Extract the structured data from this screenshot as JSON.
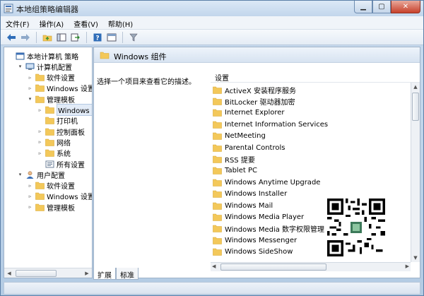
{
  "window": {
    "title": "本地组策略编辑器"
  },
  "menu": [
    "文件(F)",
    "操作(A)",
    "查看(V)",
    "帮助(H)"
  ],
  "tree": [
    {
      "label": "本地计算机 策略",
      "indent": 0,
      "icon": "computer-policy-icon",
      "expander": ""
    },
    {
      "label": "计算机配置",
      "indent": 1,
      "icon": "computer-icon",
      "expander": "▾"
    },
    {
      "label": "软件设置",
      "indent": 2,
      "icon": "folder-icon",
      "expander": "▹"
    },
    {
      "label": "Windows 设置",
      "indent": 2,
      "icon": "folder-icon",
      "expander": "▹"
    },
    {
      "label": "管理模板",
      "indent": 2,
      "icon": "folder-icon",
      "expander": "▾"
    },
    {
      "label": "Windows 组件",
      "indent": 3,
      "icon": "folder-icon",
      "expander": "▹",
      "selected": true
    },
    {
      "label": "打印机",
      "indent": 3,
      "icon": "folder-icon",
      "expander": ""
    },
    {
      "label": "控制面板",
      "indent": 3,
      "icon": "folder-icon",
      "expander": "▹"
    },
    {
      "label": "网络",
      "indent": 3,
      "icon": "folder-icon",
      "expander": "▹"
    },
    {
      "label": "系统",
      "indent": 3,
      "icon": "folder-icon",
      "expander": "▹"
    },
    {
      "label": "所有设置",
      "indent": 3,
      "icon": "settings-list-icon",
      "expander": ""
    },
    {
      "label": "用户配置",
      "indent": 1,
      "icon": "user-icon",
      "expander": "▾"
    },
    {
      "label": "软件设置",
      "indent": 2,
      "icon": "folder-icon",
      "expander": "▹"
    },
    {
      "label": "Windows 设置",
      "indent": 2,
      "icon": "folder-icon",
      "expander": "▹"
    },
    {
      "label": "管理模板",
      "indent": 2,
      "icon": "folder-icon",
      "expander": "▹"
    }
  ],
  "main": {
    "header_title": "Windows 组件",
    "description": "选择一个项目来查看它的描述。",
    "column_header": "设置",
    "items": [
      "ActiveX 安装程序服务",
      "BitLocker 驱动器加密",
      "Internet Explorer",
      "Internet Information Services",
      "NetMeeting",
      "Parental Controls",
      "RSS 提要",
      "Tablet PC",
      "Windows Anytime Upgrade",
      "Windows Installer",
      "Windows Mail",
      "Windows Media Player",
      "Windows Media 数字权限管理",
      "Windows Messenger",
      "Windows SideShow"
    ]
  },
  "tabs": [
    "扩展",
    "标准"
  ],
  "colors": {
    "folder": "#f3c85a",
    "folder_dark": "#d9a832",
    "accent": "#3b6fb6"
  }
}
